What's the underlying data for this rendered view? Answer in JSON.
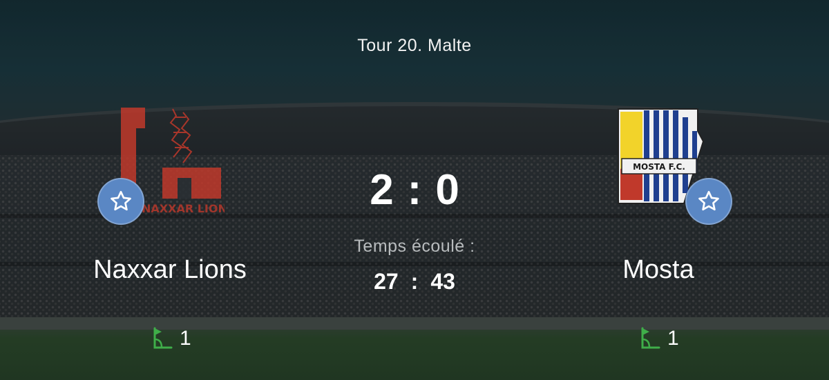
{
  "match": {
    "round_label": "Tour 20. Malte",
    "home": {
      "name": "Naxxar Lions",
      "score": "2",
      "corners": "1",
      "logo_text": "NAXXAR LIONS",
      "logo_color": "#c0392b"
    },
    "away": {
      "name": "Mosta",
      "score": "0",
      "corners": "1",
      "logo_text": "MOSTA F.C.",
      "logo_stripe_color": "#1f3f8f"
    },
    "score_separator": ":",
    "elapsed_label": "Temps écoulé :",
    "elapsed_minutes": "27",
    "elapsed_separator": ":",
    "elapsed_seconds": "43"
  },
  "icons": {
    "favorite": "star-icon",
    "corner": "corner-flag-icon"
  },
  "colors": {
    "favorite_bg": "#5a87c4",
    "corner_icon": "#3fae49"
  }
}
